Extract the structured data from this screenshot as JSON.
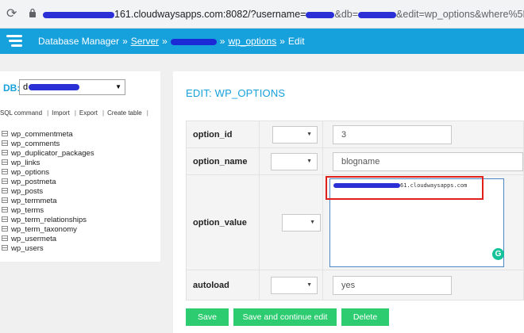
{
  "browser": {
    "url_before": "161.cloudwaysapps.com:8082/?username=",
    "url_mid": "&db=",
    "url_after": "&edit=wp_options&where%5Boption_id%5D"
  },
  "header": {
    "breadcrumbs": [
      "Database Manager",
      "Server",
      "wp_options",
      "Edit"
    ],
    "separator": "»",
    "color": "#16a0dc"
  },
  "sidebar": {
    "db_label": "DB:",
    "db_selected_prefix": "d",
    "actions": [
      "SQL command",
      "Import",
      "Export",
      "Create table"
    ],
    "tables": [
      "wp_commentmeta",
      "wp_comments",
      "wp_duplicator_packages",
      "wp_links",
      "wp_options",
      "wp_postmeta",
      "wp_posts",
      "wp_termmeta",
      "wp_terms",
      "wp_term_relationships",
      "wp_term_taxonomy",
      "wp_usermeta",
      "wp_users"
    ]
  },
  "main": {
    "title": "EDIT: WP_OPTIONS",
    "rows": [
      {
        "field": "option_id",
        "value": "3"
      },
      {
        "field": "option_name",
        "value": "blogname"
      },
      {
        "field": "option_value",
        "value": "61.cloudwaysapps.com"
      },
      {
        "field": "autoload",
        "value": "yes"
      }
    ],
    "buttons": {
      "save": "Save",
      "save_continue": "Save and continue edit",
      "delete": "Delete"
    },
    "button_color": "#2ecc71",
    "highlight_color": "#e0201b"
  }
}
